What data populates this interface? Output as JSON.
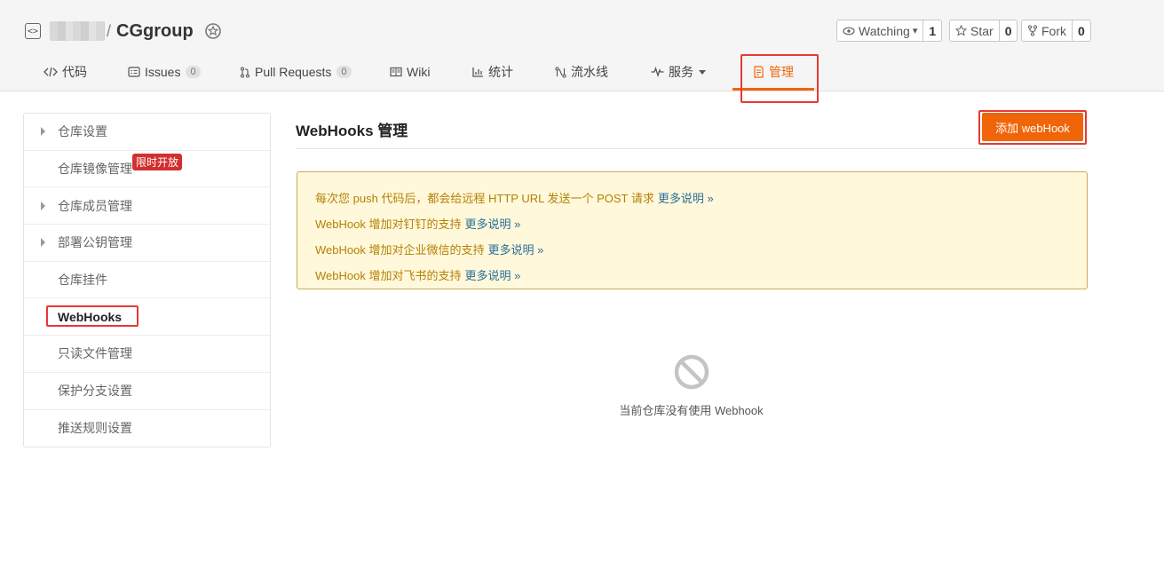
{
  "repo": {
    "name": "CGgroup",
    "slash": "/"
  },
  "actions": {
    "watching": {
      "label": "Watching",
      "caret": "▾",
      "count": "1"
    },
    "star": {
      "label": "Star",
      "count": "0"
    },
    "fork": {
      "label": "Fork",
      "count": "0"
    }
  },
  "tabs": [
    {
      "label": "代码"
    },
    {
      "label": "Issues",
      "count": "0"
    },
    {
      "label": "Pull Requests",
      "count": "0"
    },
    {
      "label": "Wiki"
    },
    {
      "label": "统计"
    },
    {
      "label": "流水线"
    },
    {
      "label": "服务"
    },
    {
      "label": "管理"
    }
  ],
  "sidebar": {
    "items": [
      {
        "label": "仓库设置"
      },
      {
        "label": "仓库镜像管理",
        "badge": "限时开放"
      },
      {
        "label": "仓库成员管理"
      },
      {
        "label": "部署公钥管理"
      },
      {
        "label": "仓库挂件"
      },
      {
        "label": "WebHooks"
      },
      {
        "label": "只读文件管理"
      },
      {
        "label": "保护分支设置"
      },
      {
        "label": "推送规则设置"
      }
    ]
  },
  "main": {
    "title": "WebHooks 管理",
    "add_button": "添加 webHook",
    "notice": [
      {
        "text": "每次您 push 代码后，都会给远程 HTTP URL 发送一个 POST 请求",
        "more": "更多说明 »"
      },
      {
        "text": "WebHook 增加对钉钉的支持",
        "more": "更多说明 »"
      },
      {
        "text": "WebHook 增加对企业微信的支持",
        "more": "更多说明 »"
      },
      {
        "text": "WebHook 增加对飞书的支持",
        "more": "更多说明 »"
      }
    ],
    "empty_text": "当前仓库没有使用 Webhook"
  },
  "colors": {
    "accent": "#f0650a",
    "highlight_border": "#e53935",
    "notice_bg": "#fff8db",
    "notice_text": "#b58105",
    "link": "#2a6f97"
  }
}
